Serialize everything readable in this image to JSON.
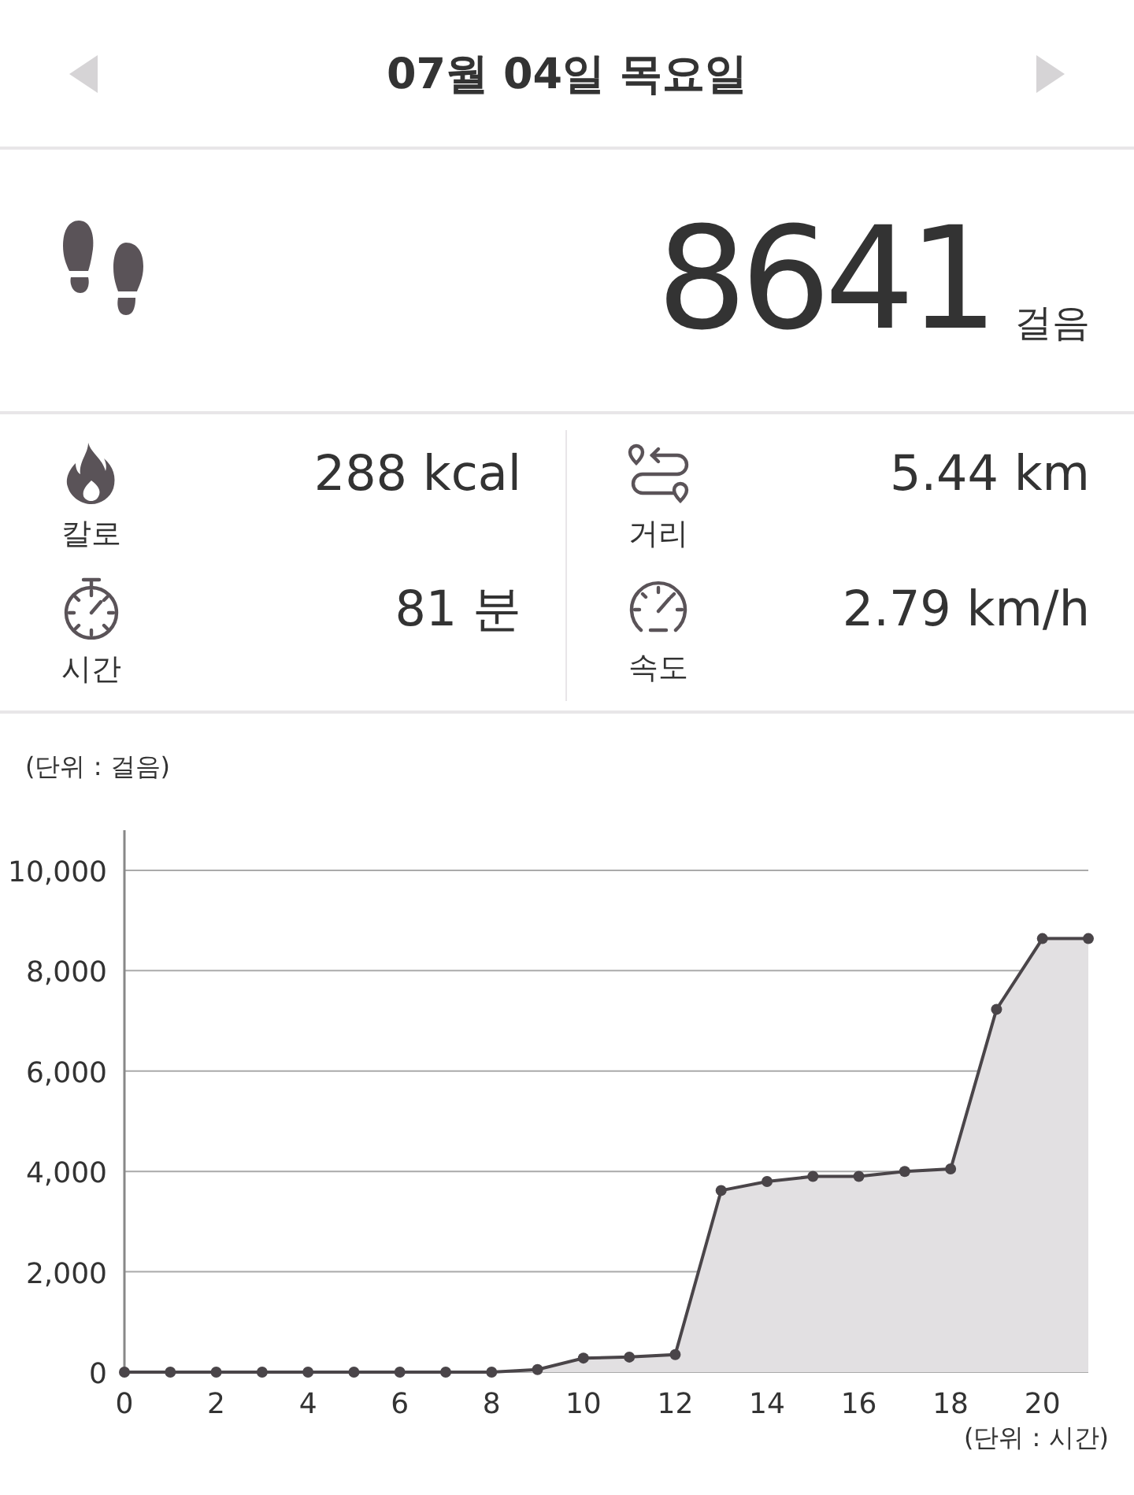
{
  "header": {
    "date": "07월 04일 목요일",
    "prev_enabled": false,
    "next_enabled": false
  },
  "steps": {
    "value": "8641",
    "unit": "걸음"
  },
  "stats": [
    {
      "kind": "calories",
      "label": "칼로",
      "value": "288 kcal"
    },
    {
      "kind": "distance",
      "label": "거리",
      "value": "5.44 km"
    },
    {
      "kind": "time",
      "label": "시간",
      "value": "81 분"
    },
    {
      "kind": "speed",
      "label": "속도",
      "value": "2.79 km/h"
    }
  ],
  "chart": {
    "chart_data": {
      "type": "area",
      "ylabel": "(단위 : 걸음)",
      "xlabel": "(단위 : 시간)",
      "x": [
        0,
        1,
        2,
        3,
        4,
        5,
        6,
        7,
        8,
        9,
        10,
        11,
        12,
        13,
        14,
        15,
        16,
        17,
        18,
        19,
        20,
        21
      ],
      "series": [
        {
          "color": "#4a4549",
          "values": [
            0,
            0,
            0,
            0,
            0,
            0,
            0,
            0,
            0,
            50,
            280,
            300,
            350,
            3620,
            3800,
            3900,
            3900,
            4000,
            4050,
            7230,
            8640,
            8640
          ]
        }
      ],
      "grid": true,
      "xlim": [
        0,
        21
      ],
      "ylim": [
        0,
        10800
      ],
      "xticks": [
        0,
        2,
        4,
        6,
        8,
        10,
        12,
        14,
        16,
        18,
        20
      ],
      "yticks": [
        {
          "value": 0,
          "label": "0"
        },
        {
          "value": 2000,
          "label": "2,000"
        },
        {
          "value": 4000,
          "label": "4,000"
        },
        {
          "value": 6000,
          "label": "6,000"
        },
        {
          "value": 8000,
          "label": "8,000"
        },
        {
          "value": 10000,
          "label": "10,000"
        }
      ]
    }
  }
}
